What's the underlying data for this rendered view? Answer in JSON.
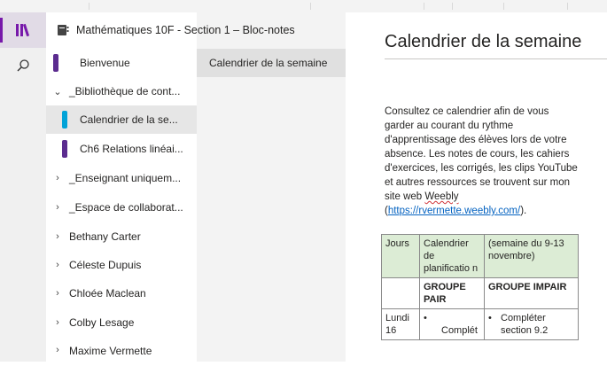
{
  "notebook": {
    "title": "Mathématiques 10F - Section 1 – Bloc-notes"
  },
  "colors": {
    "accent": "#7719aa",
    "section_purple": "#5b2c8f",
    "section_cyan": "#00a3d8",
    "table_header": "#dcecd5"
  },
  "rail": {
    "items": [
      {
        "icon": "notebooks-icon"
      },
      {
        "icon": "search-icon"
      }
    ]
  },
  "nav": {
    "items": [
      {
        "label": "Bienvenue",
        "chevron": "",
        "tab_color": "#5b2c8f"
      },
      {
        "label": "_Bibliothèque de cont...",
        "chevron": "⌄",
        "tab_color": ""
      },
      {
        "label": "Calendrier de la se...",
        "chevron": "",
        "tab_color": "#00a3d8"
      },
      {
        "label": "Ch6 Relations linéai...",
        "chevron": "",
        "tab_color": "#5b2c8f"
      },
      {
        "label": "_Enseignant uniquem...",
        "chevron": "›",
        "tab_color": ""
      },
      {
        "label": "_Espace de collaborat...",
        "chevron": "›",
        "tab_color": ""
      },
      {
        "label": "Bethany Carter",
        "chevron": "›",
        "tab_color": ""
      },
      {
        "label": "Céleste Dupuis",
        "chevron": "›",
        "tab_color": ""
      },
      {
        "label": "Chloée Maclean",
        "chevron": "›",
        "tab_color": ""
      },
      {
        "label": "Colby Lesage",
        "chevron": "›",
        "tab_color": ""
      },
      {
        "label": "Maxime Vermette",
        "chevron": "›",
        "tab_color": ""
      }
    ]
  },
  "pages": {
    "items": [
      {
        "label": "Calendrier de la semaine"
      }
    ]
  },
  "page": {
    "title": "Calendrier de la semaine",
    "paragraph_lines": [
      "Consultez ce calendrier afin de vous",
      "garder au courant du rythme",
      "d'apprentissage des élèves lors de votre",
      "absence. Les notes de cours, les cahiers",
      "d'exercices, les corrigés, les clips YouTube",
      "et autres ressources se trouvent sur mon"
    ],
    "site_prefix": "site web ",
    "site_name": "Weebly",
    "link_open": "(",
    "link": "https://rvermette.weebly.com/",
    "link_close": ").",
    "table": {
      "header": [
        "Jours",
        "Calendrier de planificatio n",
        "(semaine du 9-13 novembre)"
      ],
      "group_row": [
        "",
        "GROUPE PAIR",
        "GROUPE IMPAIR"
      ],
      "monday": {
        "day": "Lundi 16",
        "c2_bullet": "•",
        "c2_text": "Complét",
        "c3_bullet": "•",
        "c3_text": "Compléter section 9.2"
      }
    }
  }
}
